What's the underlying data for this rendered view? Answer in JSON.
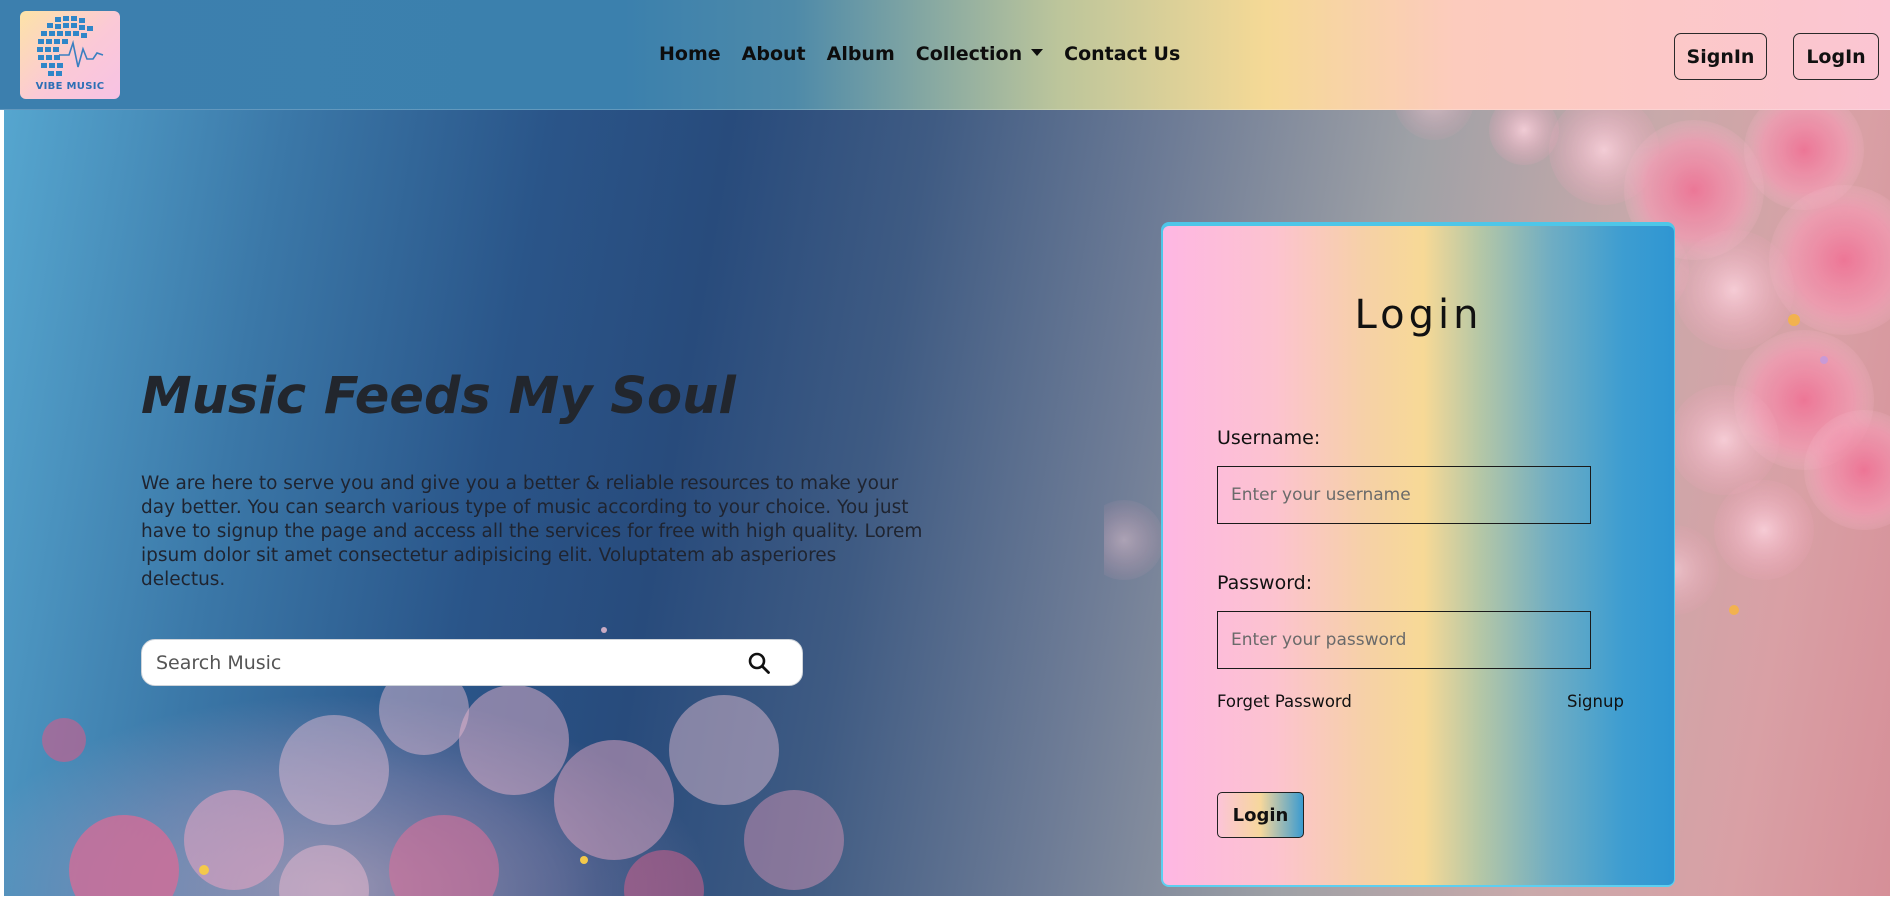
{
  "navbar": {
    "logo_text": "VIBE MUSIC",
    "links": [
      "Home",
      "About",
      "Album",
      "Collection",
      "Contact Us"
    ],
    "signin_label": "SignIn",
    "login_label": "LogIn"
  },
  "hero": {
    "title": "Music Feeds My Soul",
    "description": "We are here to serve you and give you a better & reliable resources to make your day better. You can search various type of music according to your choice. You just have to signup the page and access all the services for free with high quality. Lorem ipsum dolor sit amet consectetur adipisicing elit. Voluptatem ab asperiores delectus.",
    "search_placeholder": "Search Music"
  },
  "login_card": {
    "title": "Login",
    "username_label": "Username:",
    "username_placeholder": "Enter your username",
    "password_label": "Password:",
    "password_placeholder": "Enter your password",
    "forget_password": "Forget Password",
    "signup": "Signup",
    "submit_label": "Login"
  },
  "icons": {
    "logo": "equalizer-heartbeat-logo",
    "search": "search-icon",
    "dropdown": "chevron-down-icon"
  },
  "colors": {
    "accent_cyan": "#4ec6e8",
    "card_pink": "#feb7e3",
    "card_yellow": "#f7d996",
    "card_blue": "#2f96d2",
    "nav_blue": "#3c7fae"
  }
}
